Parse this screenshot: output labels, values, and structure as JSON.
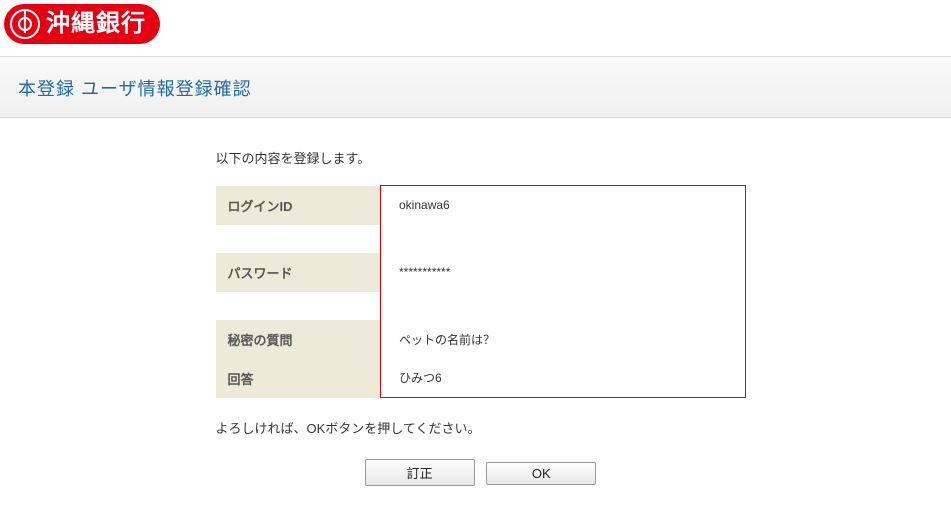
{
  "brand": {
    "name": "沖縄銀行"
  },
  "page": {
    "title": "本登録 ユーザ情報登録確認"
  },
  "intro": "以下の内容を登録します。",
  "fields": {
    "login_id": {
      "label": "ログインID",
      "value": "okinawa6"
    },
    "password": {
      "label": "パスワード",
      "value": "***********"
    },
    "secret_q": {
      "label": "秘密の質問",
      "value": "ペットの名前は？"
    },
    "answer": {
      "label": "回答",
      "value": "ひみつ6"
    }
  },
  "note": "よろしければ、OKボタンを押してください。",
  "buttons": {
    "correct": "訂正",
    "ok": "OK"
  }
}
